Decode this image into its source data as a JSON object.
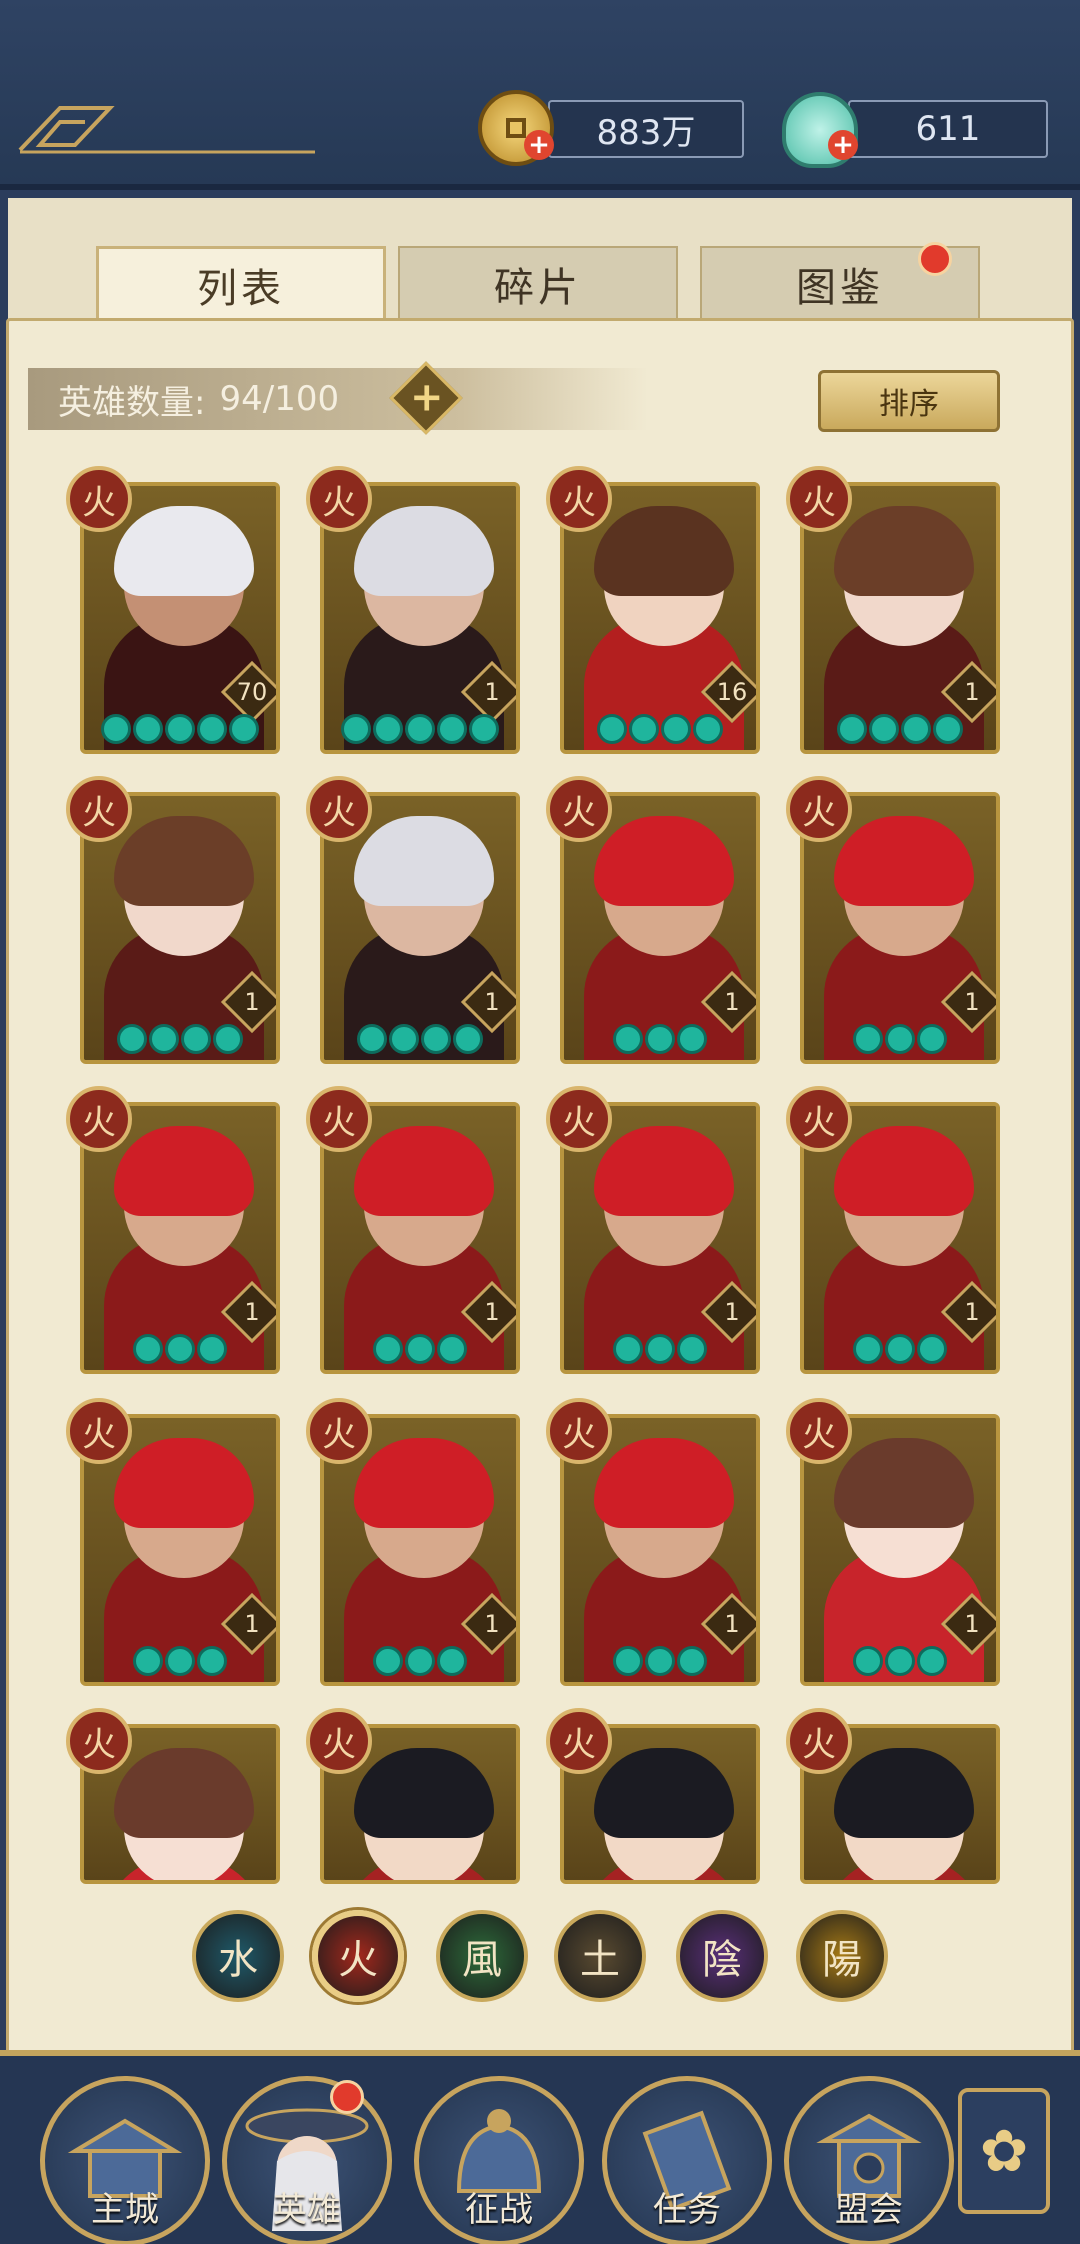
{
  "currency": {
    "coins": "883万",
    "jade": "611"
  },
  "tabs": [
    {
      "label": "列表"
    },
    {
      "label": "碎片"
    },
    {
      "label": "图鉴"
    }
  ],
  "hero_count": {
    "label": "英雄数量:",
    "value": "94/100"
  },
  "sort_button": "排序",
  "element_badge": "火",
  "heroes": [
    {
      "level": "70",
      "stars": 5,
      "hair": "#e9e9ee",
      "skin": "#c49074",
      "outfit": "#3a1413"
    },
    {
      "level": "1",
      "stars": 5,
      "hair": "#dcdce3",
      "skin": "#dcb7a1",
      "outfit": "#2a1a1a"
    },
    {
      "level": "16",
      "stars": 4,
      "hair": "#5a3320",
      "skin": "#f0d3c0",
      "outfit": "#b31f1f"
    },
    {
      "level": "1",
      "stars": 4,
      "hair": "#6b3e28",
      "skin": "#f1d8cb",
      "outfit": "#5a1b17"
    },
    {
      "level": "1",
      "stars": 4,
      "hair": "#6b3e28",
      "skin": "#f1d8cb",
      "outfit": "#5a1b17"
    },
    {
      "level": "1",
      "stars": 4,
      "hair": "#dcdce3",
      "skin": "#dcb7a1",
      "outfit": "#2a1a1a"
    },
    {
      "level": "1",
      "stars": 3,
      "hair": "#cf1e26",
      "skin": "#d7a98c",
      "outfit": "#8b1a1a"
    },
    {
      "level": "1",
      "stars": 3,
      "hair": "#cf1e26",
      "skin": "#d7a98c",
      "outfit": "#8b1a1a"
    },
    {
      "level": "1",
      "stars": 3,
      "hair": "#cf1e26",
      "skin": "#d7a98c",
      "outfit": "#8b1a1a"
    },
    {
      "level": "1",
      "stars": 3,
      "hair": "#cf1e26",
      "skin": "#d7a98c",
      "outfit": "#8b1a1a"
    },
    {
      "level": "1",
      "stars": 3,
      "hair": "#cf1e26",
      "skin": "#d7a98c",
      "outfit": "#8b1a1a"
    },
    {
      "level": "1",
      "stars": 3,
      "hair": "#cf1e26",
      "skin": "#d7a98c",
      "outfit": "#8b1a1a"
    },
    {
      "level": "1",
      "stars": 3,
      "hair": "#cf1e26",
      "skin": "#d7a98c",
      "outfit": "#8b1a1a"
    },
    {
      "level": "1",
      "stars": 3,
      "hair": "#cf1e26",
      "skin": "#d7a98c",
      "outfit": "#8b1a1a"
    },
    {
      "level": "1",
      "stars": 3,
      "hair": "#cf1e26",
      "skin": "#d7a98c",
      "outfit": "#8b1a1a"
    },
    {
      "level": "1",
      "stars": 3,
      "hair": "#6a3b2c",
      "skin": "#f6dfd3",
      "outfit": "#c8242b"
    },
    {
      "level": "",
      "stars": 0,
      "hair": "#6a3b2c",
      "skin": "#f6dfd3",
      "outfit": "#c8242b"
    },
    {
      "level": "",
      "stars": 0,
      "hair": "#1b1b22",
      "skin": "#f2d9c6",
      "outfit": "#a52222"
    },
    {
      "level": "",
      "stars": 0,
      "hair": "#1b1b22",
      "skin": "#f2d9c6",
      "outfit": "#a52222"
    },
    {
      "level": "",
      "stars": 0,
      "hair": "#1b1b22",
      "skin": "#f2d9c6",
      "outfit": "#a52222"
    }
  ],
  "elements": [
    {
      "glyph": "水",
      "color": "#1f5a6a",
      "selected": false
    },
    {
      "glyph": "火",
      "color": "#a3281c",
      "selected": true
    },
    {
      "glyph": "風",
      "color": "#2d6b3a",
      "selected": false
    },
    {
      "glyph": "土",
      "color": "#5a4b31",
      "selected": false
    },
    {
      "glyph": "陰",
      "color": "#5a2f7a",
      "selected": false
    },
    {
      "glyph": "陽",
      "color": "#a77a15",
      "selected": false
    }
  ],
  "nav": [
    {
      "label": "主城"
    },
    {
      "label": "英雄"
    },
    {
      "label": "征战"
    },
    {
      "label": "任务"
    },
    {
      "label": "盟会"
    }
  ],
  "colors": {
    "accent_gold": "#c7a45e",
    "navy": "#2b3d5c",
    "parchment": "#f1ead2"
  }
}
